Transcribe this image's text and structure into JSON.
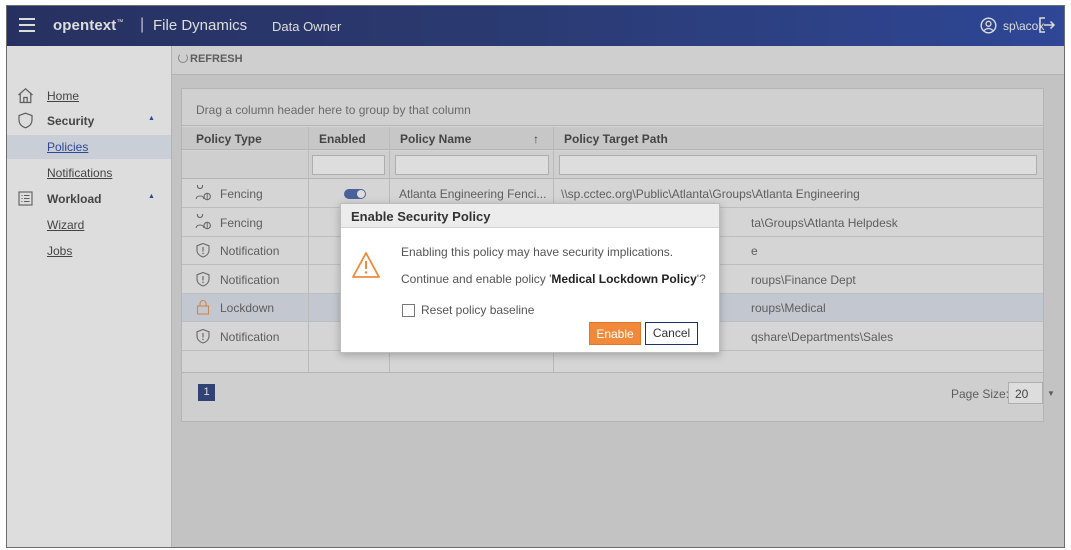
{
  "topbar": {
    "brand": "opentext",
    "brand_mark": "™",
    "separator": "|",
    "product": "File Dynamics",
    "role": "Data Owner",
    "user": "sp\\acox"
  },
  "sidebar": {
    "home": "Home",
    "security": "Security",
    "policies": "Policies",
    "notifications": "Notifications",
    "workload": "Workload",
    "wizard": "Wizard",
    "jobs": "Jobs"
  },
  "toolbar": {
    "refresh": "REFRESH"
  },
  "grid": {
    "group_hint": "Drag a column header here to group by that column",
    "columns": [
      "Policy Type",
      "Enabled",
      "Policy Name",
      "Policy Target Path"
    ],
    "sort_indicator": "↑",
    "rows": [
      {
        "type": "Fencing",
        "icon": "fencing-icon",
        "enabled": true,
        "name": "Atlanta Engineering Fenci...",
        "path": "\\\\sp.cctec.org\\Public\\Atlanta\\Groups\\Atlanta Engineering"
      },
      {
        "type": "Fencing",
        "icon": "fencing-icon",
        "enabled": false,
        "name": "",
        "path": "ta\\Groups\\Atlanta Helpdesk"
      },
      {
        "type": "Notification",
        "icon": "shield-icon",
        "enabled": false,
        "name": "",
        "path": "e"
      },
      {
        "type": "Notification",
        "icon": "shield-icon",
        "enabled": false,
        "name": "",
        "path": "roups\\Finance Dept"
      },
      {
        "type": "Lockdown",
        "icon": "lock-icon",
        "enabled": false,
        "name": "",
        "path": "roups\\Medical"
      },
      {
        "type": "Notification",
        "icon": "shield-icon",
        "enabled": false,
        "name": "",
        "path": "qshare\\Departments\\Sales"
      }
    ],
    "current_page": "1",
    "page_size_label": "Page Size:",
    "page_size": "20"
  },
  "dialog": {
    "title": "Enable Security Policy",
    "message1": "Enabling this policy may have security implications.",
    "message2_prefix": "Continue and enable policy '",
    "policy_name": "Medical Lockdown Policy",
    "message2_suffix": "'?",
    "checkbox_label": "Reset policy baseline",
    "enable": "Enable",
    "cancel": "Cancel"
  },
  "colors": {
    "accent": "#1637a0",
    "enable_button": "#f08a3a",
    "topbar": "#0d1a5a"
  }
}
